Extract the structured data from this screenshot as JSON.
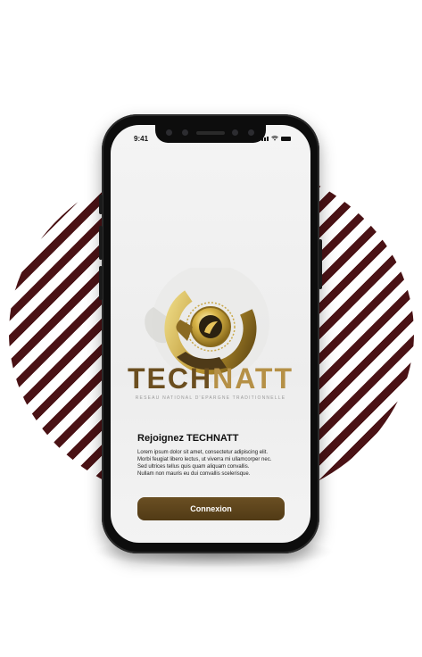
{
  "status_bar": {
    "time": "9:41"
  },
  "brand": {
    "name_part1": "TECH",
    "name_part2": "NATT",
    "tagline": "RESEAU NATIONAL D'EPARGNE TRADITIONNELLE"
  },
  "welcome": {
    "heading": "Rejoignez TECHNATT",
    "body_lines": [
      "Lorem ipsum dolor sit amet, consectetur adipiscing elit.",
      "Morbi feugiat libero lectus, ut viverra mi ullamcorper nec.",
      "Sed ultrices tellus quis quam aliquam convallis.",
      "Nullam non mauris eu dui convallis scelerisque."
    ]
  },
  "actions": {
    "connect_label": "Connexion"
  },
  "colors": {
    "stripe": "#4a1215",
    "brand_dark": "#6b4e1f",
    "brand_gold": "#b59046",
    "button": "#5e4419"
  }
}
